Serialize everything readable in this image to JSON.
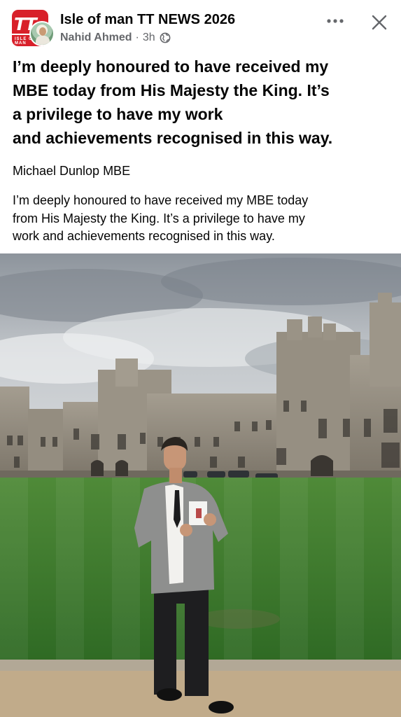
{
  "post": {
    "page_name": "Isle of man TT NEWS 2026",
    "author": "Nahid Ahmed",
    "separator": "·",
    "timestamp": "3h",
    "audience_icon": "globe-icon",
    "more_icon": "more-options-icon",
    "close_icon": "close-icon",
    "logo": {
      "monogram": "TT",
      "tagline": "ISLE OF MAN",
      "color": "#d8202a"
    },
    "headline_lines": [
      "I’m deeply honoured to have received my",
      "MBE today from His Majesty the King. It’s",
      "a privilege to have my work",
      "and achievements recognised in this way."
    ],
    "signature": "Michael Dunlop MBE",
    "body_lines": [
      "I’m deeply honoured to have received my MBE today",
      "from His Majesty the King. It’s a privilege to have my",
      "work and achievements recognised in this way."
    ]
  },
  "colors": {
    "primary_text": "#050505",
    "secondary_text": "#65676b",
    "lawn": "#3f7a2e",
    "sky": "#b7bcc2",
    "stone": "#8a8478"
  }
}
